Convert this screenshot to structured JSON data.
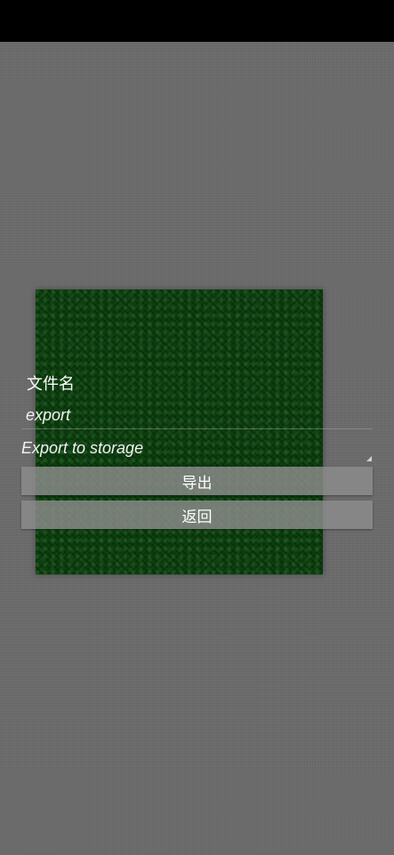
{
  "dialog": {
    "filename_label": "文件名",
    "filename_value": "export",
    "destination_selected": "Export to storage",
    "export_button": "导出",
    "back_button": "返回"
  },
  "colors": {
    "background": "#6b6b6b",
    "panel_green": "#0c3a0f",
    "button_bg": "#8c8c8c",
    "text": "#ffffff"
  }
}
